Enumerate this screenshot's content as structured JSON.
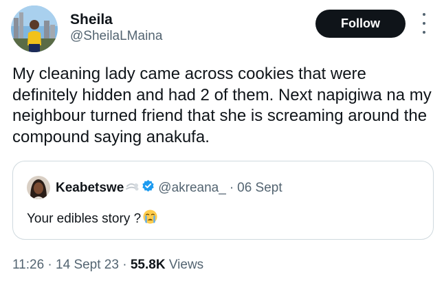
{
  "author": {
    "display_name": "Sheila",
    "handle": "@SheilaLMaina",
    "avatar_icon": "profile-photo-avatar"
  },
  "follow_button": {
    "label": "Follow"
  },
  "more_menu_icon": "vertical-ellipsis-icon",
  "tweet": {
    "text": "My cleaning lady came across cookies that were definitely hidden and had 2 of them. Next napigiwa na my neighbour turned friend that she is screaming around the compound saying anakufa."
  },
  "quoted_tweet": {
    "display_name": "Keabetswe",
    "name_emoji": "dash-emoji",
    "verified_icon": "verified-badge-icon",
    "handle": "@akreana_",
    "separator": "·",
    "date": "06 Sept",
    "text": "Your edibles story ?",
    "text_emoji": "crying-face-emoji"
  },
  "meta": {
    "time": "11:26",
    "separator": "·",
    "date": "14 Sept 23",
    "views_count": "55.8K",
    "views_label": "Views"
  },
  "colors": {
    "text_primary": "#0f1419",
    "text_secondary": "#536471",
    "border": "#cfd9de",
    "verified_blue": "#1d9bf0",
    "follow_bg": "#0f1419"
  }
}
